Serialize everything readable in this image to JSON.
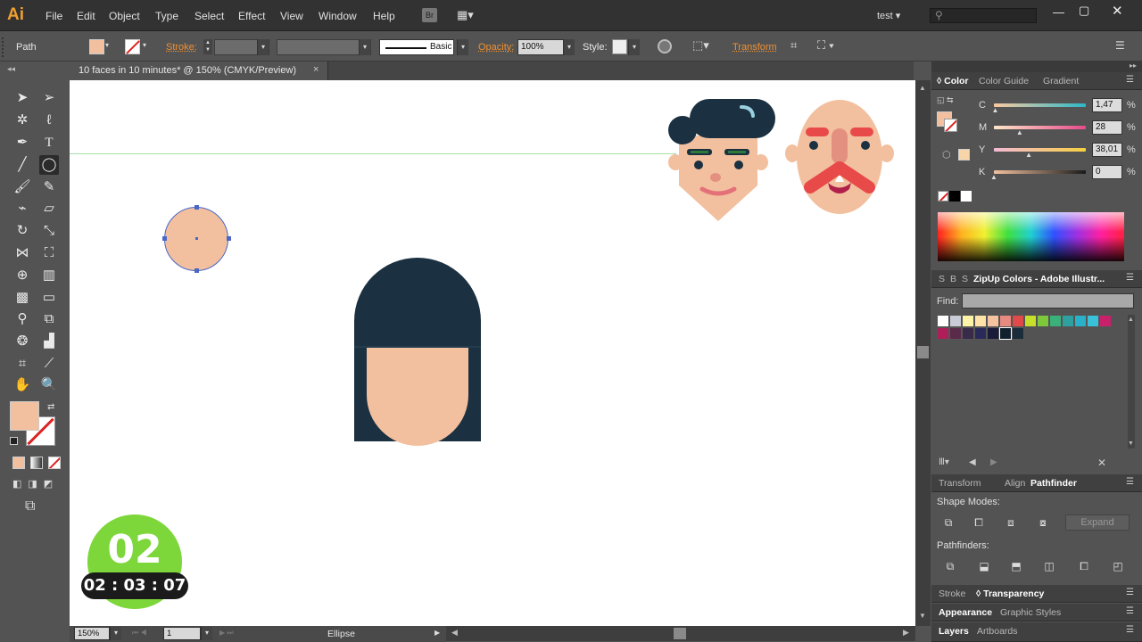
{
  "app": {
    "logo": "Ai",
    "workspace": "test"
  },
  "menu": [
    "File",
    "Edit",
    "Object",
    "Type",
    "Select",
    "Effect",
    "View",
    "Window",
    "Help"
  ],
  "control": {
    "selection": "Path",
    "stroke_label": "Stroke:",
    "brush_label": "Basic",
    "opacity_label": "Opacity:",
    "opacity_value": "100%",
    "style_label": "Style:",
    "transform_label": "Transform"
  },
  "document": {
    "tab": "10 faces in 10 minutes* @ 150% (CMYK/Preview)",
    "close": "×"
  },
  "status": {
    "zoom": "150%",
    "artboard": "1",
    "tool": "Ellipse"
  },
  "timer": {
    "count": "02",
    "time": "02 : 03 : 07"
  },
  "color_panel": {
    "tabs": [
      "Color",
      "Color Guide",
      "Gradient"
    ],
    "channels": [
      {
        "label": "C",
        "value": "1,47",
        "pct": "%",
        "level": 0.015
      },
      {
        "label": "M",
        "value": "28",
        "pct": "%",
        "level": 0.28
      },
      {
        "label": "Y",
        "value": "38,01",
        "pct": "%",
        "level": 0.38
      },
      {
        "label": "K",
        "value": "0",
        "pct": "%",
        "level": 0.0
      }
    ]
  },
  "swatch_panel": {
    "tabs": [
      "S",
      "B",
      "S",
      "ZipUp Colors - Adobe Illustr..."
    ],
    "find_label": "Find:",
    "swatches": [
      "#ffffff",
      "#c9ccd6",
      "#fff3a8",
      "#ffe3a8",
      "#f5c3a0",
      "#e88a80",
      "#e04a4a",
      "#c6e02a",
      "#7cc83a",
      "#3ab07a",
      "#2fa0a0",
      "#2ab0c8",
      "#3ac0d8",
      "#c8206a",
      "#b01e5a",
      "#5a2a4a",
      "#3a2a4a",
      "#2a2a5a",
      "#1a1a3a",
      "#10202e",
      "#1b2d3a"
    ]
  },
  "pathfinder_panel": {
    "tabs": [
      "Transform",
      "Align",
      "Pathfinder"
    ],
    "shape_modes_label": "Shape Modes:",
    "expand_label": "Expand",
    "pathfinders_label": "Pathfinders:"
  },
  "bottom_panels": [
    {
      "tabs": [
        "Stroke",
        "Transparency"
      ],
      "active": 1
    },
    {
      "tabs": [
        "Appearance",
        "Graphic Styles"
      ],
      "active": 0
    },
    {
      "tabs": [
        "Layers",
        "Artboards"
      ],
      "active": 0
    }
  ],
  "colors": {
    "skin": "#f2c09e",
    "hair": "#1b3040",
    "accent": "#f09030",
    "mustache": "#e84a4a",
    "green": "#7dd63a"
  }
}
